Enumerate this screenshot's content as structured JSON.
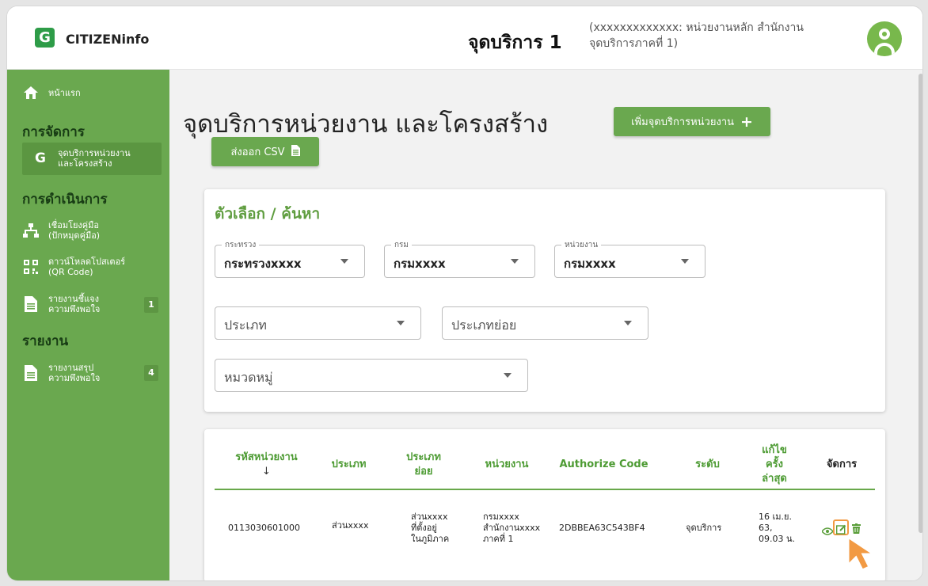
{
  "header": {
    "brand": "CITIZENinfo",
    "title": "จุดบริการ 1",
    "info_line1": "(xxxxxxxxxxxxx: หน่วยงานหลัก สำนักงาน",
    "info_line2": "จุดบริการภาคที่ 1)"
  },
  "sidebar": {
    "home": "หน้าแรก",
    "section_manage": "การจัดการ",
    "item_service_l1": "จุดบริการหน่วยงาน",
    "item_service_l2": "และโครงสร้าง",
    "section_operation": "การดำเนินการ",
    "item_link_l1": "เชื่อมโยงคู่มือ",
    "item_link_l2": "(ปักหมุดคู่มือ)",
    "item_download_l1": "ดาวน์โหลดโปสเตอร์",
    "item_download_l2": "(QR Code)",
    "item_report1_l1": "รายงานชี้แจง",
    "item_report1_l2": "ความพึงพอใจ",
    "badge_report1": "1",
    "section_report": "รายงาน",
    "item_report2_l1": "รายงานสรุป",
    "item_report2_l2": "ความพึงพอใจ",
    "badge_report2": "4"
  },
  "main": {
    "page_title": "จุดบริการหน่วยงาน และโครงสร้าง",
    "add_button": "เพิ่มจุดบริการหน่วยงาน",
    "export_button": "ส่งออก CSV"
  },
  "filter": {
    "title": "ตัวเลือก / ค้นหา",
    "ministry_label": "กระทรวง",
    "ministry_value": "กระทรวงxxxx",
    "department_label": "กรม",
    "department_value": "กรมxxxx",
    "unit_label": "หน่วยงาน",
    "unit_value": "กรมxxxx",
    "type_placeholder": "ประเภท",
    "subtype_placeholder": "ประเภทย่อย",
    "category_placeholder": "หมวดหมู่"
  },
  "table": {
    "headers": {
      "code": "รหัสหน่วยงาน",
      "sort": "↓",
      "type": "ประเภท",
      "subtype_l1": "ประเภท",
      "subtype_l2": "ย่อย",
      "unit": "หน่วยงาน",
      "auth": "Authorize Code",
      "level": "ระดับ",
      "updated_l1": "แก้ไข",
      "updated_l2": "ครั้ง",
      "updated_l3": "ล่าสุด",
      "manage": "จัดการ"
    },
    "row": {
      "code": "0113030601000",
      "type": "ส่วนxxxx",
      "subtype_l1": "ส่วนxxxx",
      "subtype_l2": "ที่ตั้งอยู่",
      "subtype_l3": "ในภูมิภาค",
      "unit_l1": "กรมxxxx",
      "unit_l2": "สำนักงานxxxx",
      "unit_l3": "ภาคที่ 1",
      "auth": "2DBBEA63C543BF4",
      "level": "จุดบริการ",
      "updated_l1": "16 เม.ย.",
      "updated_l2": "63,",
      "updated_l3": "09.03 น."
    }
  },
  "colors": {
    "accent": "#6aa84f",
    "sidebar": "#6aa84f",
    "highlight": "#f29a43"
  }
}
